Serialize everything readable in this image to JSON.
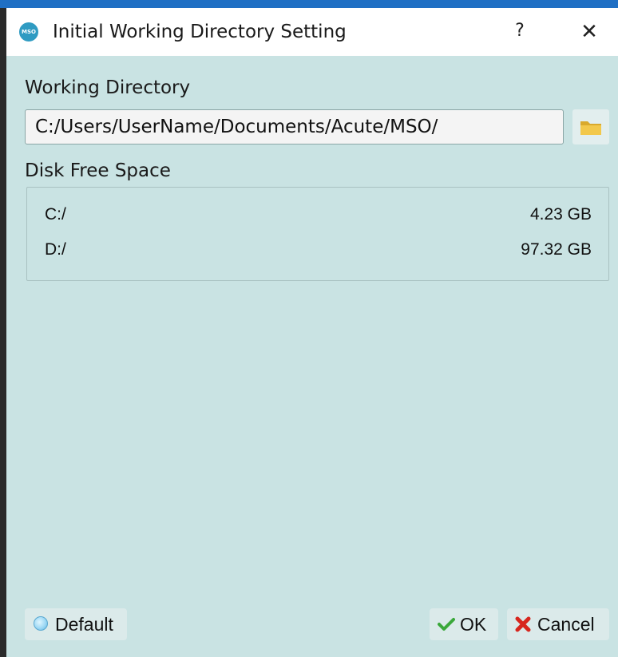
{
  "window": {
    "title": "Initial Working Directory Setting",
    "app_icon_text": "MSO",
    "help_label": "?",
    "close_label": "✕"
  },
  "working_directory": {
    "label": "Working Directory",
    "value": "C:/Users/UserName/Documents/Acute/MSO/",
    "folder_icon": "folder-icon"
  },
  "disk_free_space": {
    "label": "Disk Free Space",
    "drives": [
      {
        "drive": "C:/",
        "free": "4.23 GB"
      },
      {
        "drive": "D:/",
        "free": "97.32 GB"
      }
    ]
  },
  "buttons": {
    "default_label": "Default",
    "ok_label": "OK",
    "cancel_label": "Cancel"
  },
  "colors": {
    "dialog_bg": "#c9e3e3",
    "titlebar_bg": "#ffffff",
    "accent_blue": "#1f6fc4",
    "ok_green": "#3aa83a",
    "cancel_red": "#d7261e",
    "folder_yellow": "#f2c84b"
  }
}
